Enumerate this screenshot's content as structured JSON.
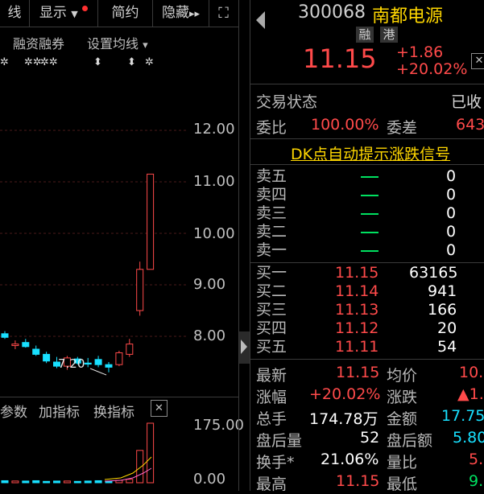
{
  "toolbar": {
    "line_tab": "线",
    "display": "显示",
    "simple": "简约",
    "hide": "隐藏",
    "hide_arrows": "▸▸",
    "fullscreen_icon": "⛶"
  },
  "subbar": {
    "margin_trading": "融资融券",
    "set_ma": "设置均线",
    "set_ma_arrow": "▾"
  },
  "chart": {
    "price_ticks": [
      "12.00",
      "11.00",
      "10.00",
      "9.00",
      "8.00"
    ],
    "annotation": "7.20",
    "indicator_tabs": {
      "params": "参数",
      "add": "加指标",
      "switch": "换指标"
    },
    "close_icon": "✕",
    "volume_ticks": [
      "175.00",
      "0.00"
    ],
    "colors": {
      "up": "#ff4a4a",
      "down": "#18e0ff"
    }
  },
  "chart_data": {
    "type": "candlestick",
    "ylim": [
      7.0,
      12.6
    ],
    "price_ticks": [
      8,
      9,
      10,
      11,
      12
    ],
    "candles": [
      {
        "o": 8.05,
        "h": 8.1,
        "l": 7.95,
        "c": 7.98
      },
      {
        "o": 7.82,
        "h": 7.92,
        "l": 7.75,
        "c": 7.85
      },
      {
        "o": 7.88,
        "h": 7.95,
        "l": 7.78,
        "c": 7.8
      },
      {
        "o": 7.75,
        "h": 7.82,
        "l": 7.62,
        "c": 7.65
      },
      {
        "o": 7.65,
        "h": 7.7,
        "l": 7.48,
        "c": 7.52
      },
      {
        "o": 7.5,
        "h": 7.6,
        "l": 7.38,
        "c": 7.42
      },
      {
        "o": 7.42,
        "h": 7.62,
        "l": 7.35,
        "c": 7.58
      },
      {
        "o": 7.56,
        "h": 7.6,
        "l": 7.45,
        "c": 7.48
      },
      {
        "o": 7.48,
        "h": 7.58,
        "l": 7.4,
        "c": 7.46
      },
      {
        "o": 7.55,
        "h": 7.62,
        "l": 7.4,
        "c": 7.45
      },
      {
        "o": 7.45,
        "h": 7.5,
        "l": 7.3,
        "c": 7.4
      },
      {
        "o": 7.45,
        "h": 7.72,
        "l": 7.42,
        "c": 7.68
      },
      {
        "o": 7.65,
        "h": 7.95,
        "l": 7.6,
        "c": 7.85
      },
      {
        "o": 8.5,
        "h": 9.45,
        "l": 8.4,
        "c": 9.3
      },
      {
        "o": 9.3,
        "h": 11.15,
        "l": 9.3,
        "c": 11.15
      }
    ],
    "volume_ylim": [
      0,
      175
    ],
    "volumes": [
      6,
      5,
      5,
      6,
      4,
      5,
      5,
      4,
      5,
      6,
      4,
      7,
      10,
      95,
      175
    ]
  },
  "quote": {
    "code": "300068",
    "name": "南都电源",
    "badges": [
      "融",
      "港"
    ],
    "price": "11.15",
    "change": "+1.86",
    "change_pct": "+20.02%",
    "trade_status_label": "交易状态",
    "trade_status": "已收",
    "ratio_label": "委比",
    "ratio": "100.00%",
    "diff_label": "委差",
    "diff": "643",
    "banner": "DK点自动提示涨跌信号"
  },
  "order_book": {
    "asks": [
      {
        "label": "卖五",
        "vol": "0"
      },
      {
        "label": "卖四",
        "vol": "0"
      },
      {
        "label": "卖三",
        "vol": "0"
      },
      {
        "label": "卖二",
        "vol": "0"
      },
      {
        "label": "卖一",
        "vol": "0"
      }
    ],
    "bids": [
      {
        "label": "买一",
        "price": "11.15",
        "vol": "63165"
      },
      {
        "label": "买二",
        "price": "11.14",
        "vol": "941"
      },
      {
        "label": "买三",
        "price": "11.13",
        "vol": "166"
      },
      {
        "label": "买四",
        "price": "11.12",
        "vol": "20"
      },
      {
        "label": "买五",
        "price": "11.11",
        "vol": "54"
      }
    ]
  },
  "stats": {
    "latest_label": "最新",
    "latest": "11.15",
    "avg_label": "均价",
    "avg": "10.",
    "pct_label": "涨幅",
    "pct": "+20.02%",
    "chg_label": "涨跌",
    "chg": "▲1.",
    "vol_label": "总手",
    "vol": "174.78万",
    "amt_label": "金额",
    "amt": "17.75",
    "after_vol_label": "盘后量",
    "after_vol": "52",
    "after_amt_label": "盘后额",
    "after_amt": "5.80",
    "turnover_label": "换手*",
    "turnover": "21.06%",
    "vr_label": "量比",
    "vr": "5.",
    "high_label": "最高",
    "high": "11.15",
    "low_label": "最低",
    "low": "9."
  }
}
